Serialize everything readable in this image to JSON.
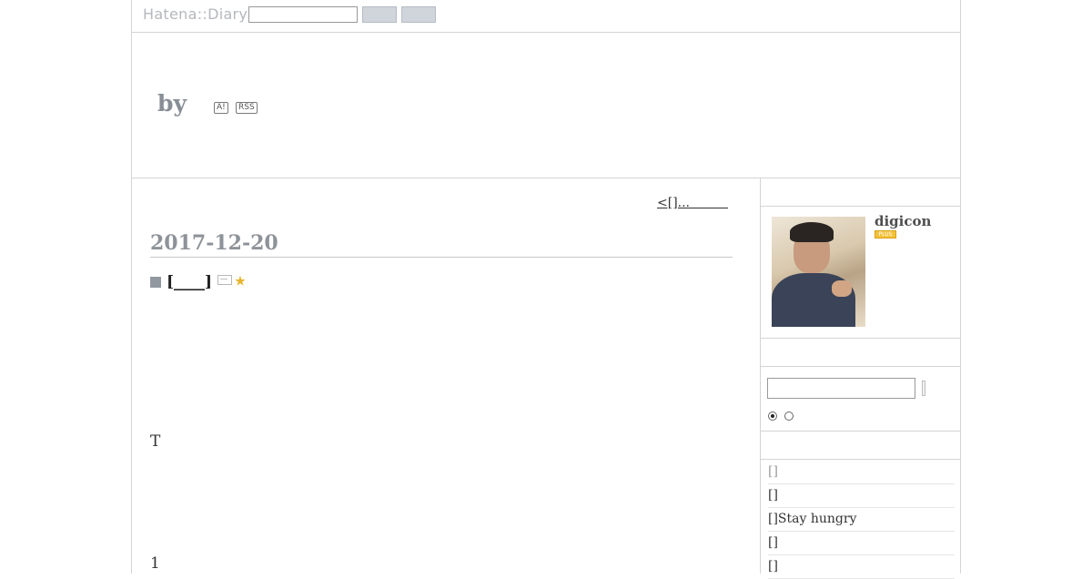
{
  "topbar": {
    "logo": "Hatena::Diary",
    "search_value": "",
    "button1_label": "",
    "button2_label": ""
  },
  "header": {
    "title": "by",
    "antenna_badge": "A!",
    "rss_badge": "RSS"
  },
  "main": {
    "prev_link": "<[]...　　　",
    "date": "2017-12-20",
    "entry_title": "[____]",
    "body_lines": [
      "T",
      "1"
    ]
  },
  "sidebar": {
    "profile": {
      "username": "digicon",
      "plus_badge": "PLUS",
      "photo": "profile-photo"
    },
    "search": {
      "value": "",
      "submit_label": ""
    },
    "radio_options": [
      {
        "checked": true
      },
      {
        "checked": false
      }
    ],
    "recent_entries": [
      {
        "label": "[]"
      },
      {
        "label": "[]"
      },
      {
        "label": "[]Stay hungry"
      },
      {
        "label": "[]"
      },
      {
        "label": "[]"
      }
    ]
  },
  "colors": {
    "date": "#8e9399",
    "title_by": "#888e96",
    "plus_badge": "#f4c23b",
    "star": "#e7b42e",
    "top_buttons": "#d0d5dc"
  },
  "icons": [
    "square-bullet-icon",
    "image-icon",
    "star-icon"
  ]
}
